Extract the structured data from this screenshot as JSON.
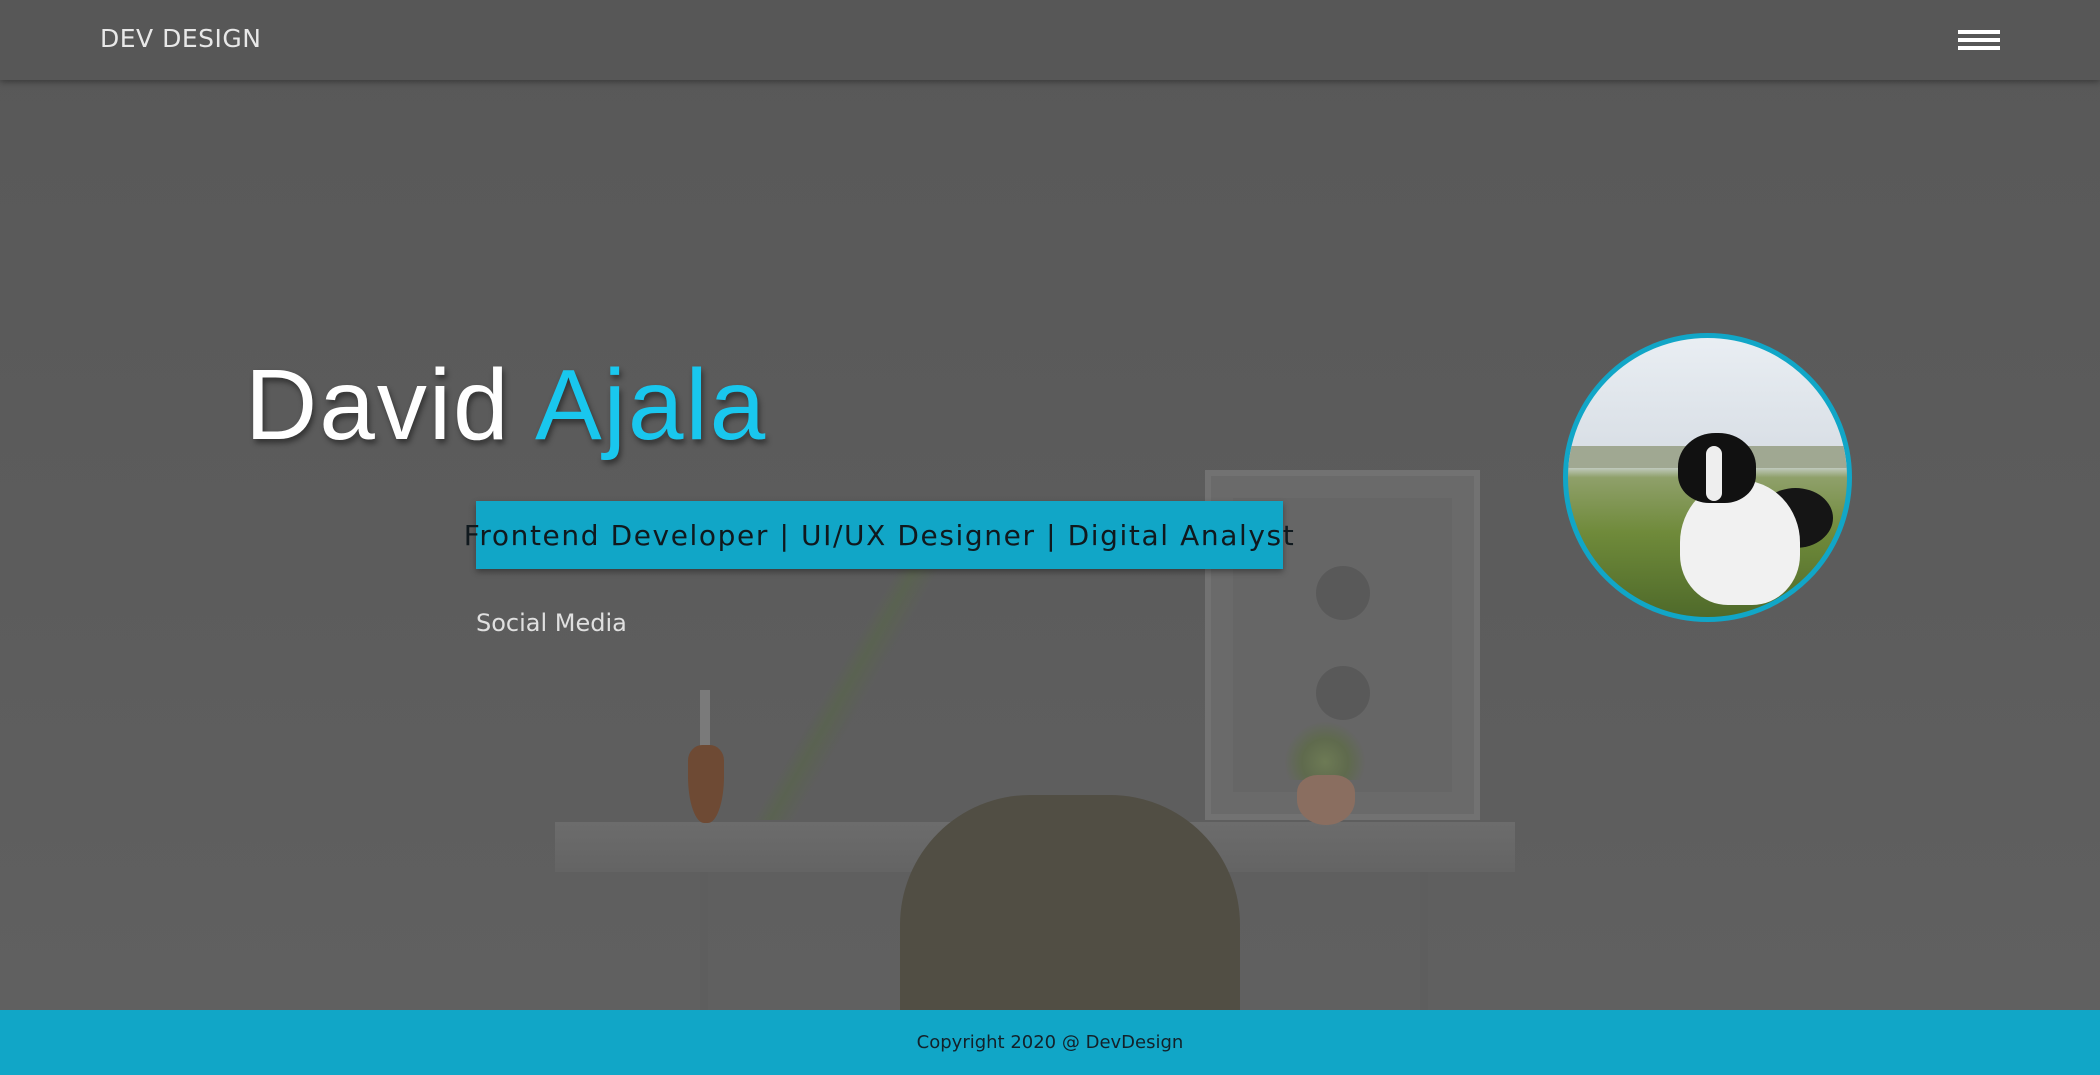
{
  "navbar": {
    "logo": "DEV DESIGN",
    "menu_icon": "hamburger-menu-icon"
  },
  "hero": {
    "first_name": "David",
    "last_name": "Ajala",
    "tagline": "Frontend Developer | UI/UX Designer | Digital Analyst",
    "social_link": "Social Media",
    "avatar_icon": "profile-photo-dog"
  },
  "footer": {
    "copyright": "Copyright 2020 @ DevDesign"
  },
  "colors": {
    "accent": "#19c7ee",
    "brand_bar": "#11a6c7",
    "overlay": "#575757"
  }
}
